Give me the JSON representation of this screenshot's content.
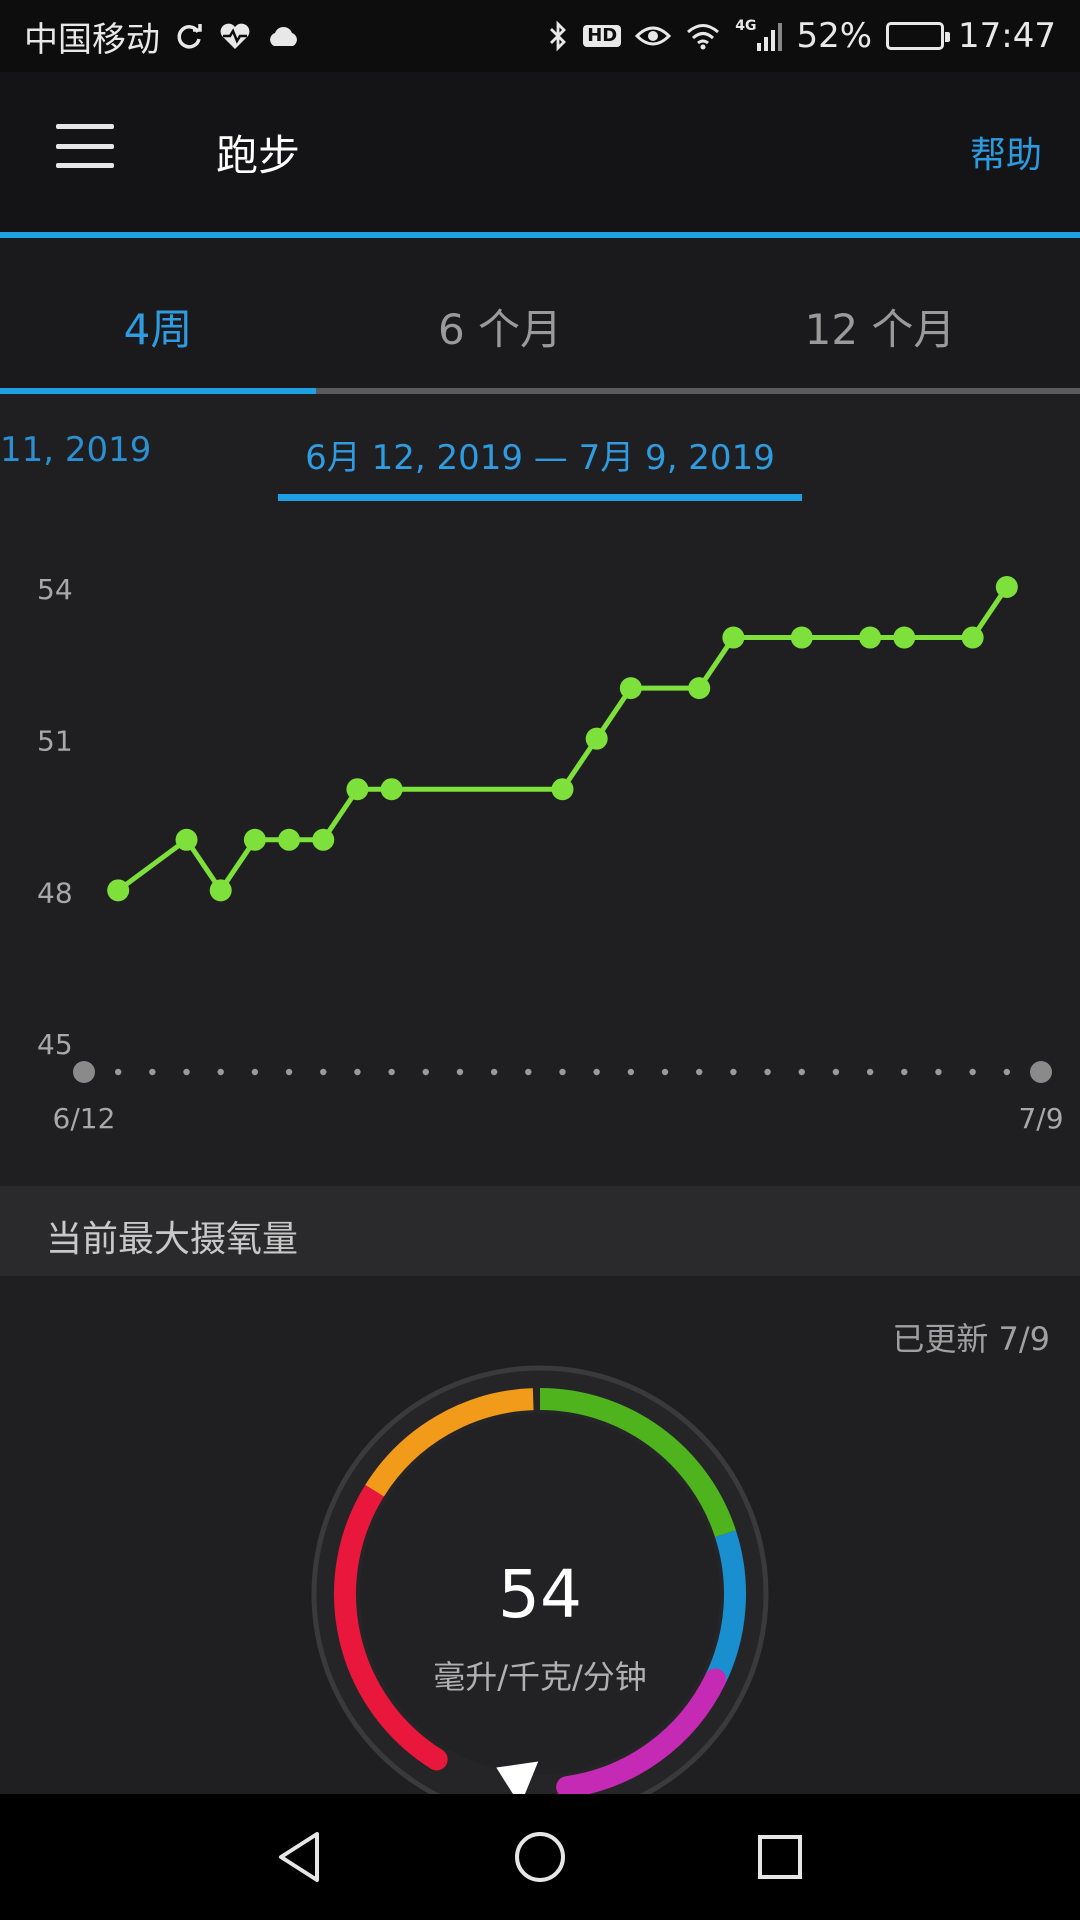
{
  "status_bar": {
    "carrier": "中国移动",
    "network": "4G",
    "battery": "52%",
    "battery_level": 0.52,
    "time": "17:47",
    "icons": [
      "sync-icon",
      "heart-rate-icon",
      "cloud-icon",
      "bluetooth-icon",
      "hd-icon",
      "eye-icon",
      "wifi-icon",
      "signal-icon",
      "battery-icon"
    ]
  },
  "app_bar": {
    "title": "跑步",
    "help": "帮助",
    "menu_icon": "hamburger-menu-icon"
  },
  "period_tabs": [
    {
      "label": "4周",
      "active": true
    },
    {
      "label": "6 个月",
      "active": false
    },
    {
      "label": "12 个月",
      "active": false
    }
  ],
  "date_range": {
    "previous": "11, 2019",
    "current": "6月 12, 2019 — 7月 9, 2019"
  },
  "chart_data": {
    "type": "line",
    "title": "",
    "xlabel": "",
    "ylabel": "",
    "ylim": [
      45,
      54
    ],
    "yticks": [
      "54",
      "51",
      "48",
      "45"
    ],
    "x_tick_labels": [
      "6/12",
      "7/9"
    ],
    "x_days": 28,
    "grid": false,
    "line_color": "#7ee03a",
    "series": [
      {
        "points": [
          {
            "day": 1,
            "value": 48
          },
          {
            "day": 3,
            "value": 49
          },
          {
            "day": 4,
            "value": 48
          },
          {
            "day": 5,
            "value": 49
          },
          {
            "day": 6,
            "value": 49
          },
          {
            "day": 7,
            "value": 49
          },
          {
            "day": 8,
            "value": 50
          },
          {
            "day": 9,
            "value": 50
          },
          {
            "day": 14,
            "value": 50
          },
          {
            "day": 15,
            "value": 51
          },
          {
            "day": 16,
            "value": 52
          },
          {
            "day": 18,
            "value": 52
          },
          {
            "day": 19,
            "value": 53
          },
          {
            "day": 21,
            "value": 53
          },
          {
            "day": 23,
            "value": 53
          },
          {
            "day": 24,
            "value": 53
          },
          {
            "day": 26,
            "value": 53
          },
          {
            "day": 27,
            "value": 54
          }
        ]
      }
    ]
  },
  "vo2": {
    "section_title": "当前最大摄氧量",
    "updated": "已更新 7/9",
    "value": "54",
    "unit": "毫升/千克/分钟",
    "segment_colors": [
      "#e8173b",
      "#f29b1a",
      "#4fb31e",
      "#1a8fd0",
      "#c42ab3"
    ]
  },
  "nav_bar": {
    "icons": [
      "back-icon",
      "home-icon",
      "recents-icon"
    ]
  }
}
